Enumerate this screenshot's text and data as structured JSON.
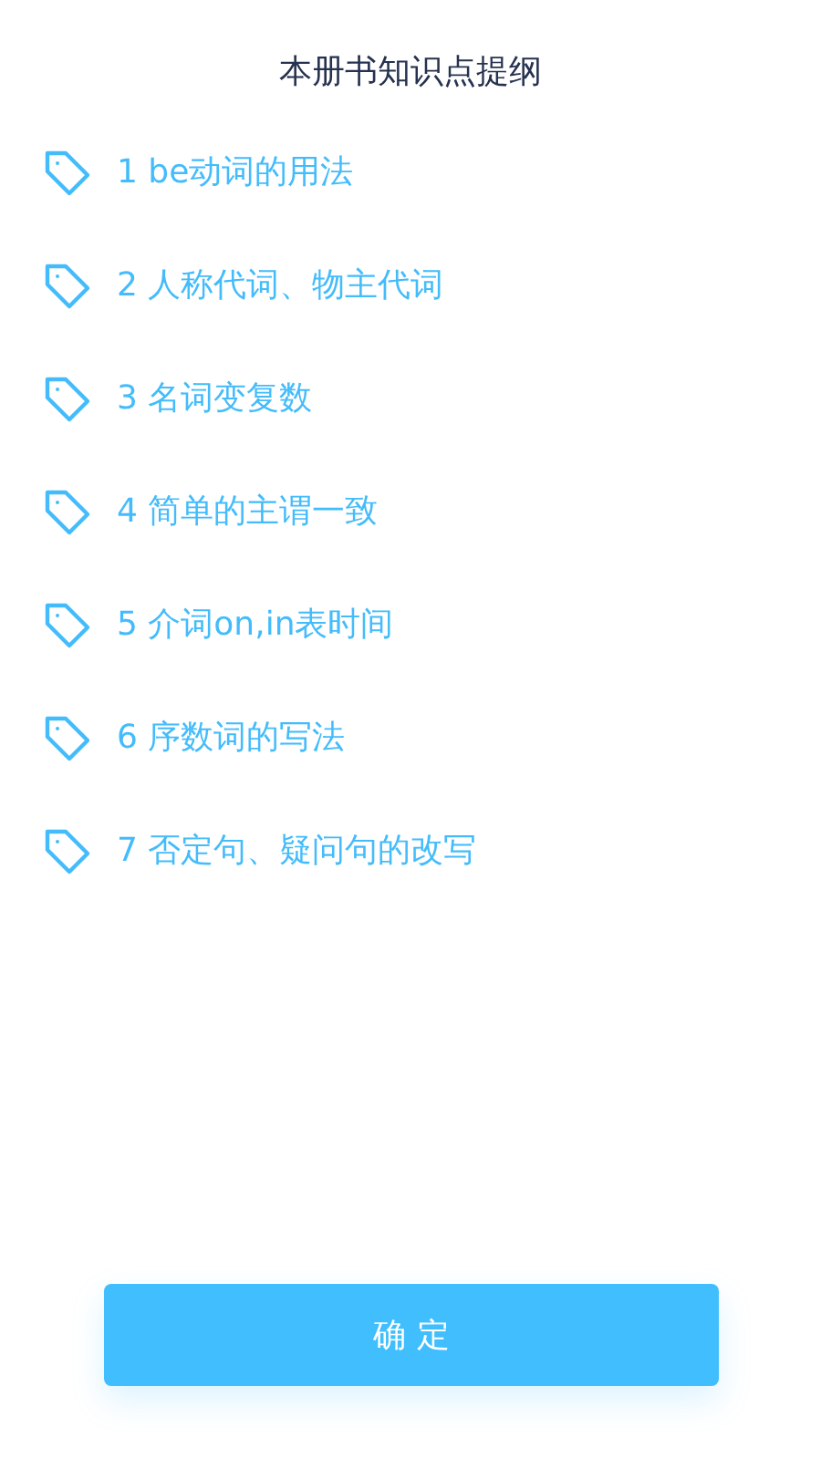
{
  "title": "本册书知识点提纲",
  "items": [
    {
      "label": "1 be动词的用法"
    },
    {
      "label": "2 人称代词、物主代词"
    },
    {
      "label": "3 名词变复数"
    },
    {
      "label": "4 简单的主谓一致"
    },
    {
      "label": "5 介词on,in表时间"
    },
    {
      "label": "6 序数词的写法"
    },
    {
      "label": "7 否定句、疑问句的改写"
    }
  ],
  "confirm_button": "确 定"
}
